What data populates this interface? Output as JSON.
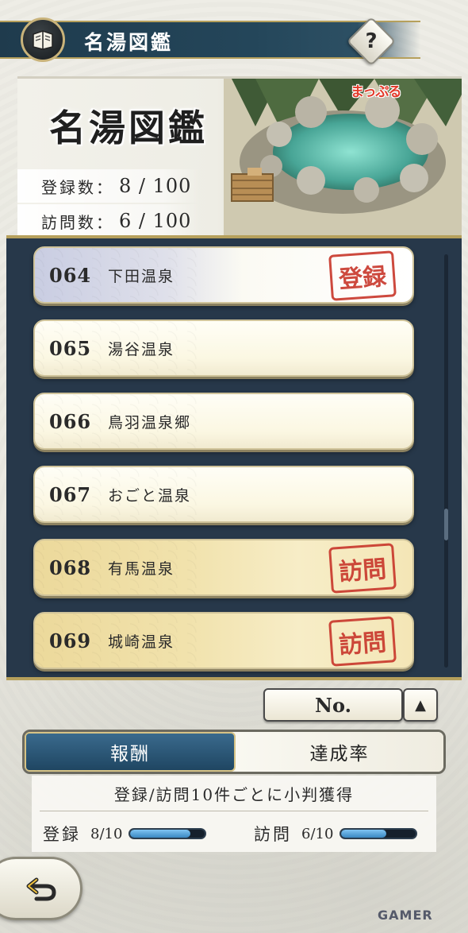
{
  "header": {
    "title": "名湯図鑑",
    "help_label": "?",
    "book_icon": "book-icon"
  },
  "banner": {
    "title": "名湯図鑑",
    "logo_text": "まっぷる",
    "registered_label": "登録数：",
    "registered_value": "8 / 100",
    "visited_label": "訪問数：",
    "visited_value": "6 / 100"
  },
  "list": {
    "items": [
      {
        "number": "064",
        "name": "下田温泉",
        "status": "registered",
        "stamp": "登録"
      },
      {
        "number": "065",
        "name": "湯谷温泉",
        "status": "none",
        "stamp": ""
      },
      {
        "number": "066",
        "name": "鳥羽温泉郷",
        "status": "none",
        "stamp": ""
      },
      {
        "number": "067",
        "name": "おごと温泉",
        "status": "none",
        "stamp": ""
      },
      {
        "number": "068",
        "name": "有馬温泉",
        "status": "visited",
        "stamp": "訪問"
      },
      {
        "number": "069",
        "name": "城崎温泉",
        "status": "visited",
        "stamp": "訪問"
      }
    ]
  },
  "sort": {
    "label": "No.",
    "direction_icon": "▲"
  },
  "tabs": [
    {
      "label": "報酬",
      "active": true
    },
    {
      "label": "達成率",
      "active": false
    }
  ],
  "info": {
    "text": "登録/訪問10件ごとに小判獲得",
    "registered_label": "登録",
    "registered_progress": "8/10",
    "registered_fraction": 0.8,
    "visited_label": "訪問",
    "visited_progress": "6/10",
    "visited_fraction": 0.6
  },
  "watermark": "GAMER",
  "colors": {
    "header_blue": "#24465a",
    "stamp_red": "#c93a2e",
    "active_tab": "#2c587a",
    "progress_fill": "#5aa6dc"
  }
}
